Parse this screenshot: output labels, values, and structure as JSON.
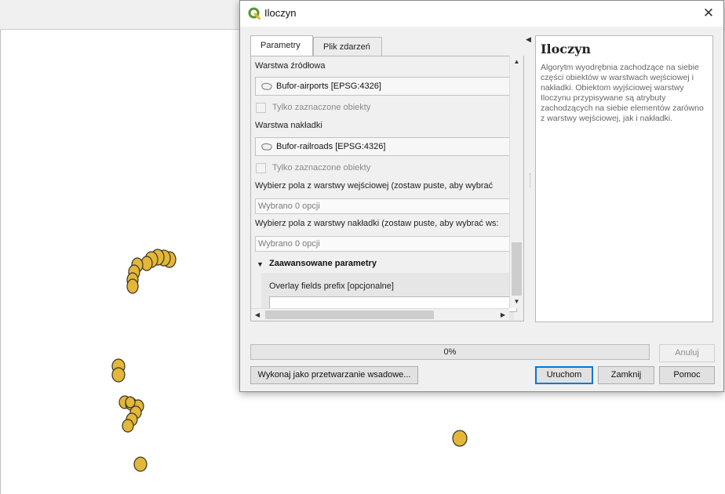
{
  "dialog": {
    "title": "Iloczyn",
    "close_glyph": "✕",
    "tabs": [
      "Parametry",
      "Plik zdarzeń"
    ],
    "params": {
      "source_layer_label": "Warstwa źródłowa",
      "source_layer_value": "Bufor-airports [EPSG:4326]",
      "selected_only_label_1": "Tylko zaznaczone obiekty",
      "overlay_layer_label": "Warstwa nakładki",
      "overlay_layer_value": "Bufor-railroads [EPSG:4326]",
      "selected_only_label_2": "Tylko zaznaczone obiekty",
      "input_fields_label": "Wybierz pola z warstwy wejściowej (zostaw puste, aby wybrać",
      "input_fields_value": "Wybrano 0 opcji",
      "overlay_fields_label": "Wybierz pola z warstwy nakładki (zostaw puste, aby wybrać ws:",
      "overlay_fields_value": "Wybrano 0 opcji",
      "advanced_label": "Zaawansowane parametry",
      "overlay_prefix_label": "Overlay fields prefix [opcjonalne]",
      "overlay_prefix_value": ""
    },
    "help": {
      "title": "Iloczyn",
      "body": "Algorytm wyodrębnia zachodzące na siebie części obiektów w warstwach wejściowej i nakładki. Obiektom wyjściowej warstwy Iloczynu przypisywane są atrybuty zachodzących na siebie elementów zarówno z warstwy wejściowej, jak i nakładki."
    },
    "progress": {
      "text": "0%",
      "value": 0
    },
    "buttons": {
      "cancel": "Anuluj",
      "batch": "Wykonaj jako przetwarzanie wsadowe...",
      "run": "Uruchom",
      "close": "Zamknij",
      "help": "Pomoc"
    }
  },
  "colors": {
    "buffer_fill": "#e2b73a",
    "buffer_stroke": "#3a3320",
    "qgis_green": "#589632",
    "accent_blue": "#0078d7"
  }
}
